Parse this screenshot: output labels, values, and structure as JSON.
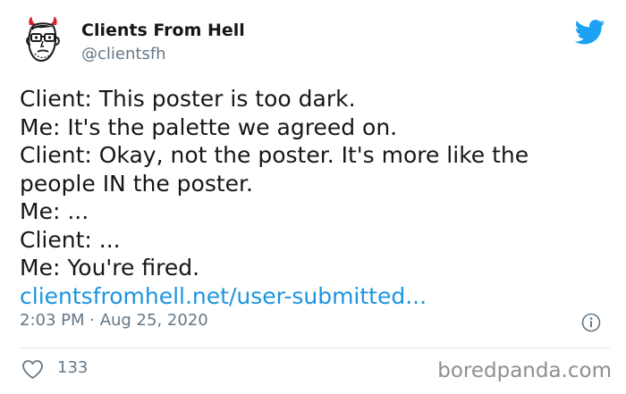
{
  "author": {
    "name": "Clients From Hell",
    "handle": "@clientsfh",
    "avatar_icon": "devil-face-avatar-icon"
  },
  "tweet": {
    "lines": [
      "Client: This poster is too dark.",
      "Me: It's the palette we agreed on.",
      "Client: Okay, not the poster. It's more like the",
      "people IN the poster.",
      "Me: ...",
      "Client: ...",
      "Me: You're fired."
    ],
    "link_text": "clientsfromhell.net/user-submitted...",
    "timestamp": "2:03 PM · Aug 25, 2020"
  },
  "actions": {
    "like_count": "133"
  },
  "watermark": "boredpanda.com",
  "colors": {
    "text": "#14171a",
    "secondary": "#657786",
    "link": "#1b95e0",
    "twitter_blue": "#1da1f2",
    "divider": "#e1e8ed",
    "watermark": "#8f8f8f"
  },
  "icons": {
    "brand": "twitter-bird-icon",
    "info": "info-icon",
    "like": "heart-outline-icon"
  }
}
